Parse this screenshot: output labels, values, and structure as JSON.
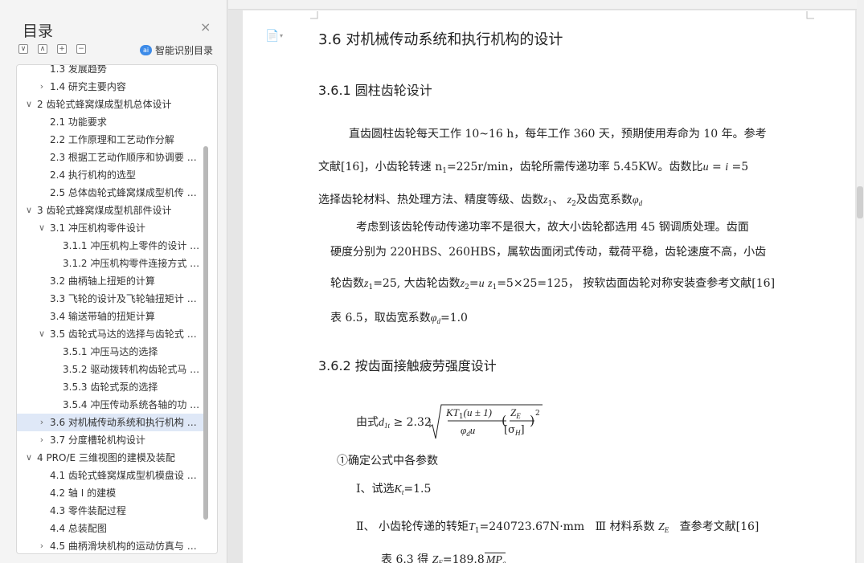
{
  "panel": {
    "title": "目录",
    "close": "×",
    "smart_toc": "智能识别目录",
    "ai_glyph": "ai",
    "toolbar": [
      "∨",
      "∧",
      "+",
      "−"
    ],
    "items": [
      {
        "label": "1.3 发展趋势",
        "arrow": ""
      },
      {
        "label": "1.4 研究主要内容",
        "arrow": "›"
      },
      {
        "label": "2 齿轮式蜂窝煤成型机总体设计",
        "arrow": "∨"
      },
      {
        "label": "2.1 功能要求",
        "arrow": ""
      },
      {
        "label": "2.2 工作原理和工艺动作分解",
        "arrow": ""
      },
      {
        "label": "2.3  根据工艺动作顺序和协调要 …",
        "arrow": ""
      },
      {
        "label": "2.4 执行机构的选型",
        "arrow": ""
      },
      {
        "label": "2.5 总体齿轮式蜂窝煤成型机传 …",
        "arrow": ""
      },
      {
        "label": "3 齿轮式蜂窝煤成型机部件设计",
        "arrow": "∨"
      },
      {
        "label": "3.1 冲压机构零件设计",
        "arrow": "∨"
      },
      {
        "label": "3.1.1 冲压机构上零件的设计 …",
        "arrow": ""
      },
      {
        "label": "3.1.2 冲压机构零件连接方式 …",
        "arrow": ""
      },
      {
        "label": "3.2 曲柄轴上扭矩的计算",
        "arrow": ""
      },
      {
        "label": "3.3 飞轮的设计及飞轮轴扭矩计 …",
        "arrow": ""
      },
      {
        "label": "3.4 输送带轴的扭矩计算",
        "arrow": ""
      },
      {
        "label": "3.5 齿轮式马达的选择与齿轮式 …",
        "arrow": "∨"
      },
      {
        "label": "3.5.1 冲压马达的选择",
        "arrow": ""
      },
      {
        "label": "3.5.2 驱动拨转机构齿轮式马 …",
        "arrow": ""
      },
      {
        "label": "3.5.3 齿轮式泵的选择",
        "arrow": ""
      },
      {
        "label": "3.5.4 冲压传动系统各轴的功 …",
        "arrow": ""
      },
      {
        "label": "3.6 对机械传动系统和执行机构 …",
        "arrow": "›",
        "active": true
      },
      {
        "label": "3.7 分度槽轮机构设计",
        "arrow": "›"
      },
      {
        "label": "4 PRO/E 三维视图的建模及装配",
        "arrow": "∨"
      },
      {
        "label": "4.1 齿轮式蜂窝煤成型机模盘设 …",
        "arrow": ""
      },
      {
        "label": "4.2 轴 I 的建模",
        "arrow": ""
      },
      {
        "label": "4.3 零件装配过程",
        "arrow": ""
      },
      {
        "label": "4.4 总装配图",
        "arrow": ""
      },
      {
        "label": "4.5 曲柄滑块机构的运动仿真与 …",
        "arrow": "›"
      }
    ]
  },
  "doc": {
    "h1": "3.6 对机械传动系统和执行机构的设计",
    "h2a": "3.6.1 圆柱齿轮设计",
    "p1_l1": "直齿圆柱齿轮每天工作 10~16 h，每年工作 360 天，预期使用寿命为 10 年。参考",
    "p1_l2a": "文献[16]，小齿轮转速 n",
    "p1_l2_sub": "1",
    "p1_l2b": "=225r/min，齿轮所需传递功率 5.45KW。齿数比",
    "p1_l2_u": "u",
    "p1_l2_eq": " = ",
    "p1_l2_i": "i",
    "p1_l2c": " =5",
    "p1_l3a": "选择齿轮材料、热处理方法、精度等级、齿数",
    "p1_l3_z1": "z",
    "p1_l3_z1s": "1",
    "p1_l3_sep": "、 ",
    "p1_l3_z2": "z",
    "p1_l3_z2s": "2",
    "p1_l3b": "及齿宽系数",
    "p1_l3_phi": "φ",
    "p1_l3_phis": "d",
    "p2_l1": "考虑到该齿轮传动传递功率不是很大，故大小齿轮都选用 45 钢调质处理。齿面",
    "p2_l2": "硬度分别为 220HBS、260HBS，属软齿面闭式传动，载荷平稳，齿轮速度不高，小齿",
    "p2_l3a": "轮齿数",
    "p2_l3_z1": "z",
    "p2_l3_z1s": "1",
    "p2_l3b": "=25, 大齿轮齿数",
    "p2_l3_z2": "z",
    "p2_l3_z2s": "2",
    "p2_l3c": "=",
    "p2_l3_u": "u",
    "p2_l3_z1b": "z",
    "p2_l3_z1bs": "1",
    "p2_l3d": "=5×25=125， 按软齿面齿轮对称安装查参考文献[16]",
    "p2_l4a": "表 6.5，取齿宽系数",
    "p2_l4_phi": "φ",
    "p2_l4_phis": "d",
    "p2_l4b": "=1.0",
    "h2b": "3.6.2 按齿面接触疲劳强度设计",
    "f_prefix": "由式",
    "f_d": "d",
    "f_ds": "1t",
    "f_ge": " ≥ 2.32",
    "f_root": "3",
    "f_num": "KT",
    "f_num_s": "1",
    "f_num_b": "(u ± 1)",
    "f_den": "φ",
    "f_den_s": "d",
    "f_den_b": "u",
    "f_ze": "Z",
    "f_ze_s": "E",
    "f_sh": "[σ",
    "f_sh_s": "H",
    "f_sh_b": "]",
    "f_sq": "2",
    "c1": "①确定公式中各参数",
    "l1a": "Ⅰ、试选",
    "l1_k": "K",
    "l1_ks": "t",
    "l1b": "=1.5",
    "l2a": "Ⅱ、  小齿轮传递的转矩",
    "l2_t": "T",
    "l2_ts": "1",
    "l2b": "=240723.67N·mm",
    "l2c": "Ⅲ  材料系数",
    "l2_z": "Z",
    "l2_zs": "E",
    "l2d": "查参考文献[16]",
    "l3a": "表 6.3 得",
    "l3_z": "Z",
    "l3_zs": "E",
    "l3b": "=189.8",
    "l3_mp": "MP",
    "l3_mps": "a"
  },
  "icons": {
    "page_icon": "📄",
    "caret": "▾"
  }
}
